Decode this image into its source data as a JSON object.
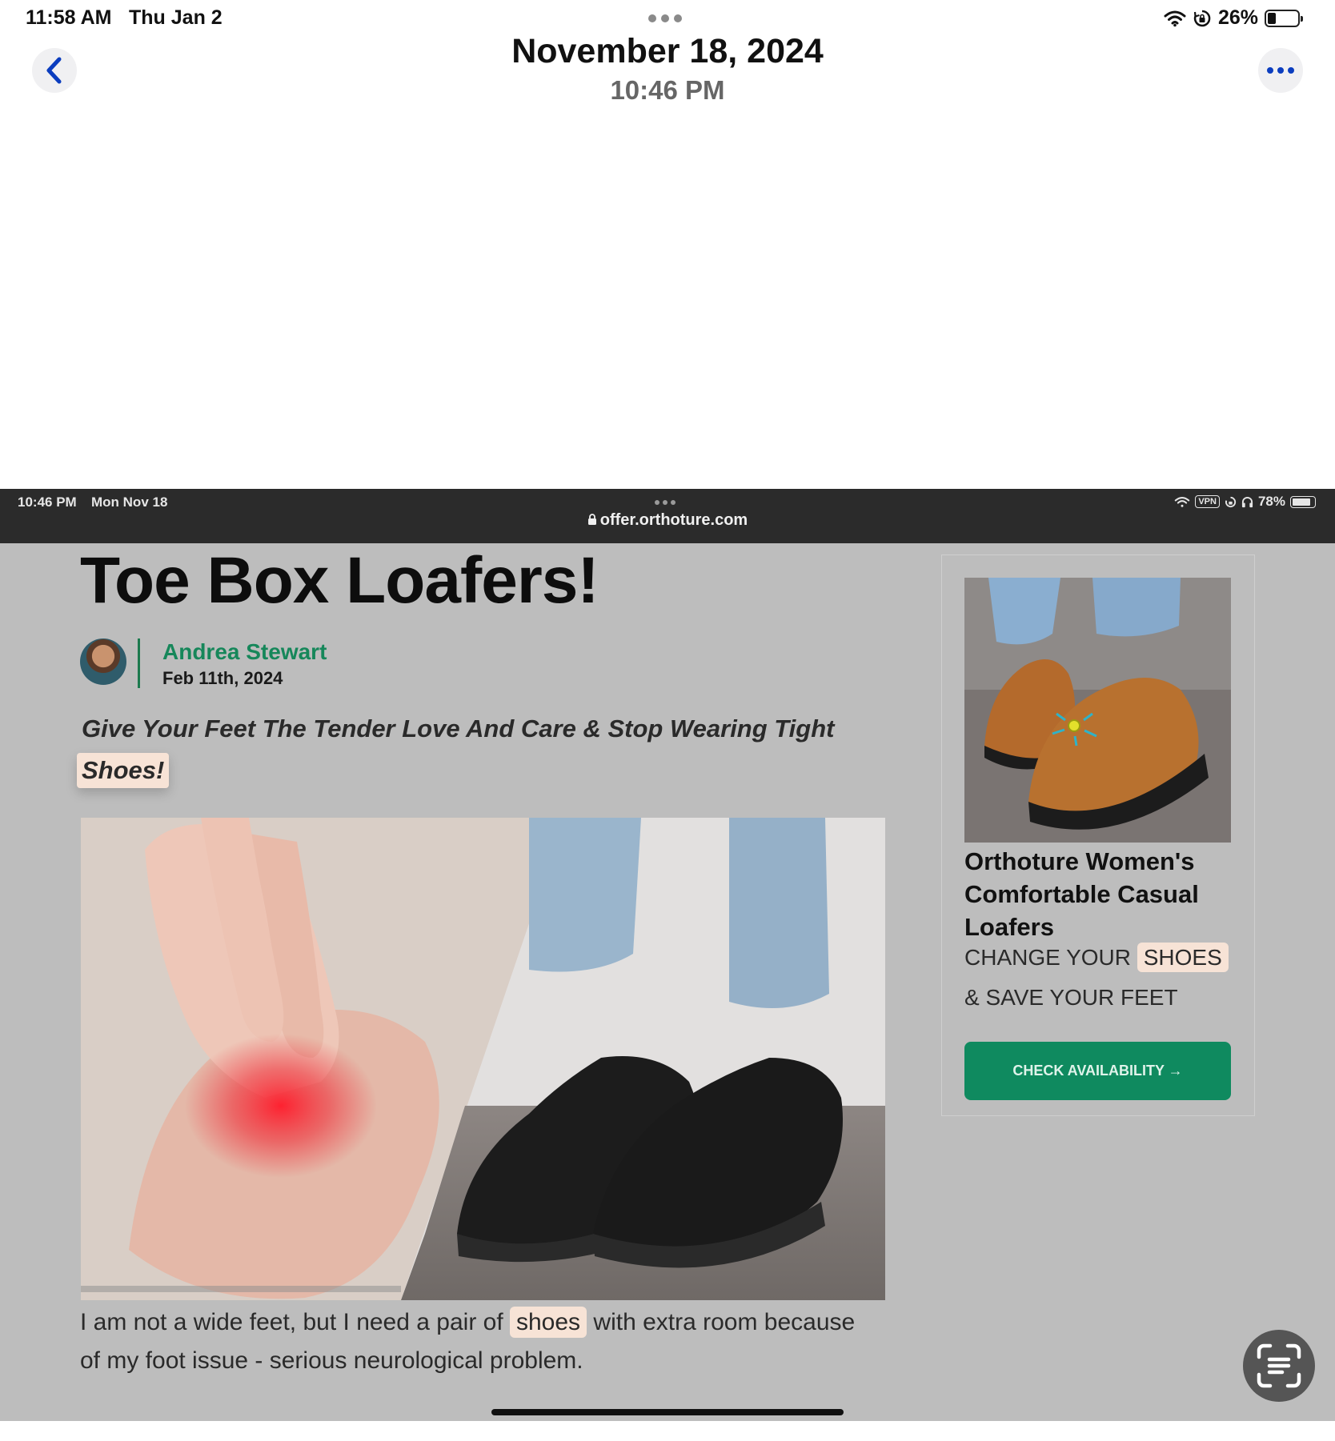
{
  "status_bar": {
    "time": "11:58 AM",
    "date": "Thu Jan 2",
    "battery": "26%",
    "battery_level": 0.26
  },
  "nav": {
    "title": "November 18, 2024",
    "subtitle": "10:46 PM"
  },
  "screenshot": {
    "status_bar": {
      "time": "10:46 PM",
      "date": "Mon Nov 18",
      "vpn": "VPN",
      "battery": "78%",
      "battery_level": 0.78
    },
    "url": "offer.orthoture.com",
    "article": {
      "headline": "Toe Box Loafers!",
      "author": "Andrea Stewart",
      "date": "Feb 11th, 2024",
      "subheadline": "Give Your Feet The Tender Love And Care & Stop Wearing Tight",
      "subheadline_highlight": "Shoes!",
      "body_before": "I am not a wide feet, but I need a pair of ",
      "body_highlight": "shoes",
      "body_after": " with extra room because of my foot issue - serious neurological problem."
    },
    "ad": {
      "title": "Orthoture Women's Comfortable Casual Loafers",
      "tagline_part1": "CHANGE YOUR ",
      "tagline_highlight": "SHOES",
      "tagline_part2": "& SAVE YOUR FEET",
      "button_label": "CHECK AVAILABILITY →"
    }
  },
  "icons": {
    "back": "chevron-left-icon",
    "more": "ellipsis-icon",
    "wifi": "wifi-icon",
    "rotation_lock": "rotation-lock-icon",
    "headphones": "headphones-icon",
    "lock": "lock-icon",
    "live_text": "live-text-icon"
  },
  "colors": {
    "accent_blue": "#0b3dbf",
    "author_green": "#16875a",
    "button_green": "#0f8a5f",
    "highlight": "#f7e3d6"
  }
}
